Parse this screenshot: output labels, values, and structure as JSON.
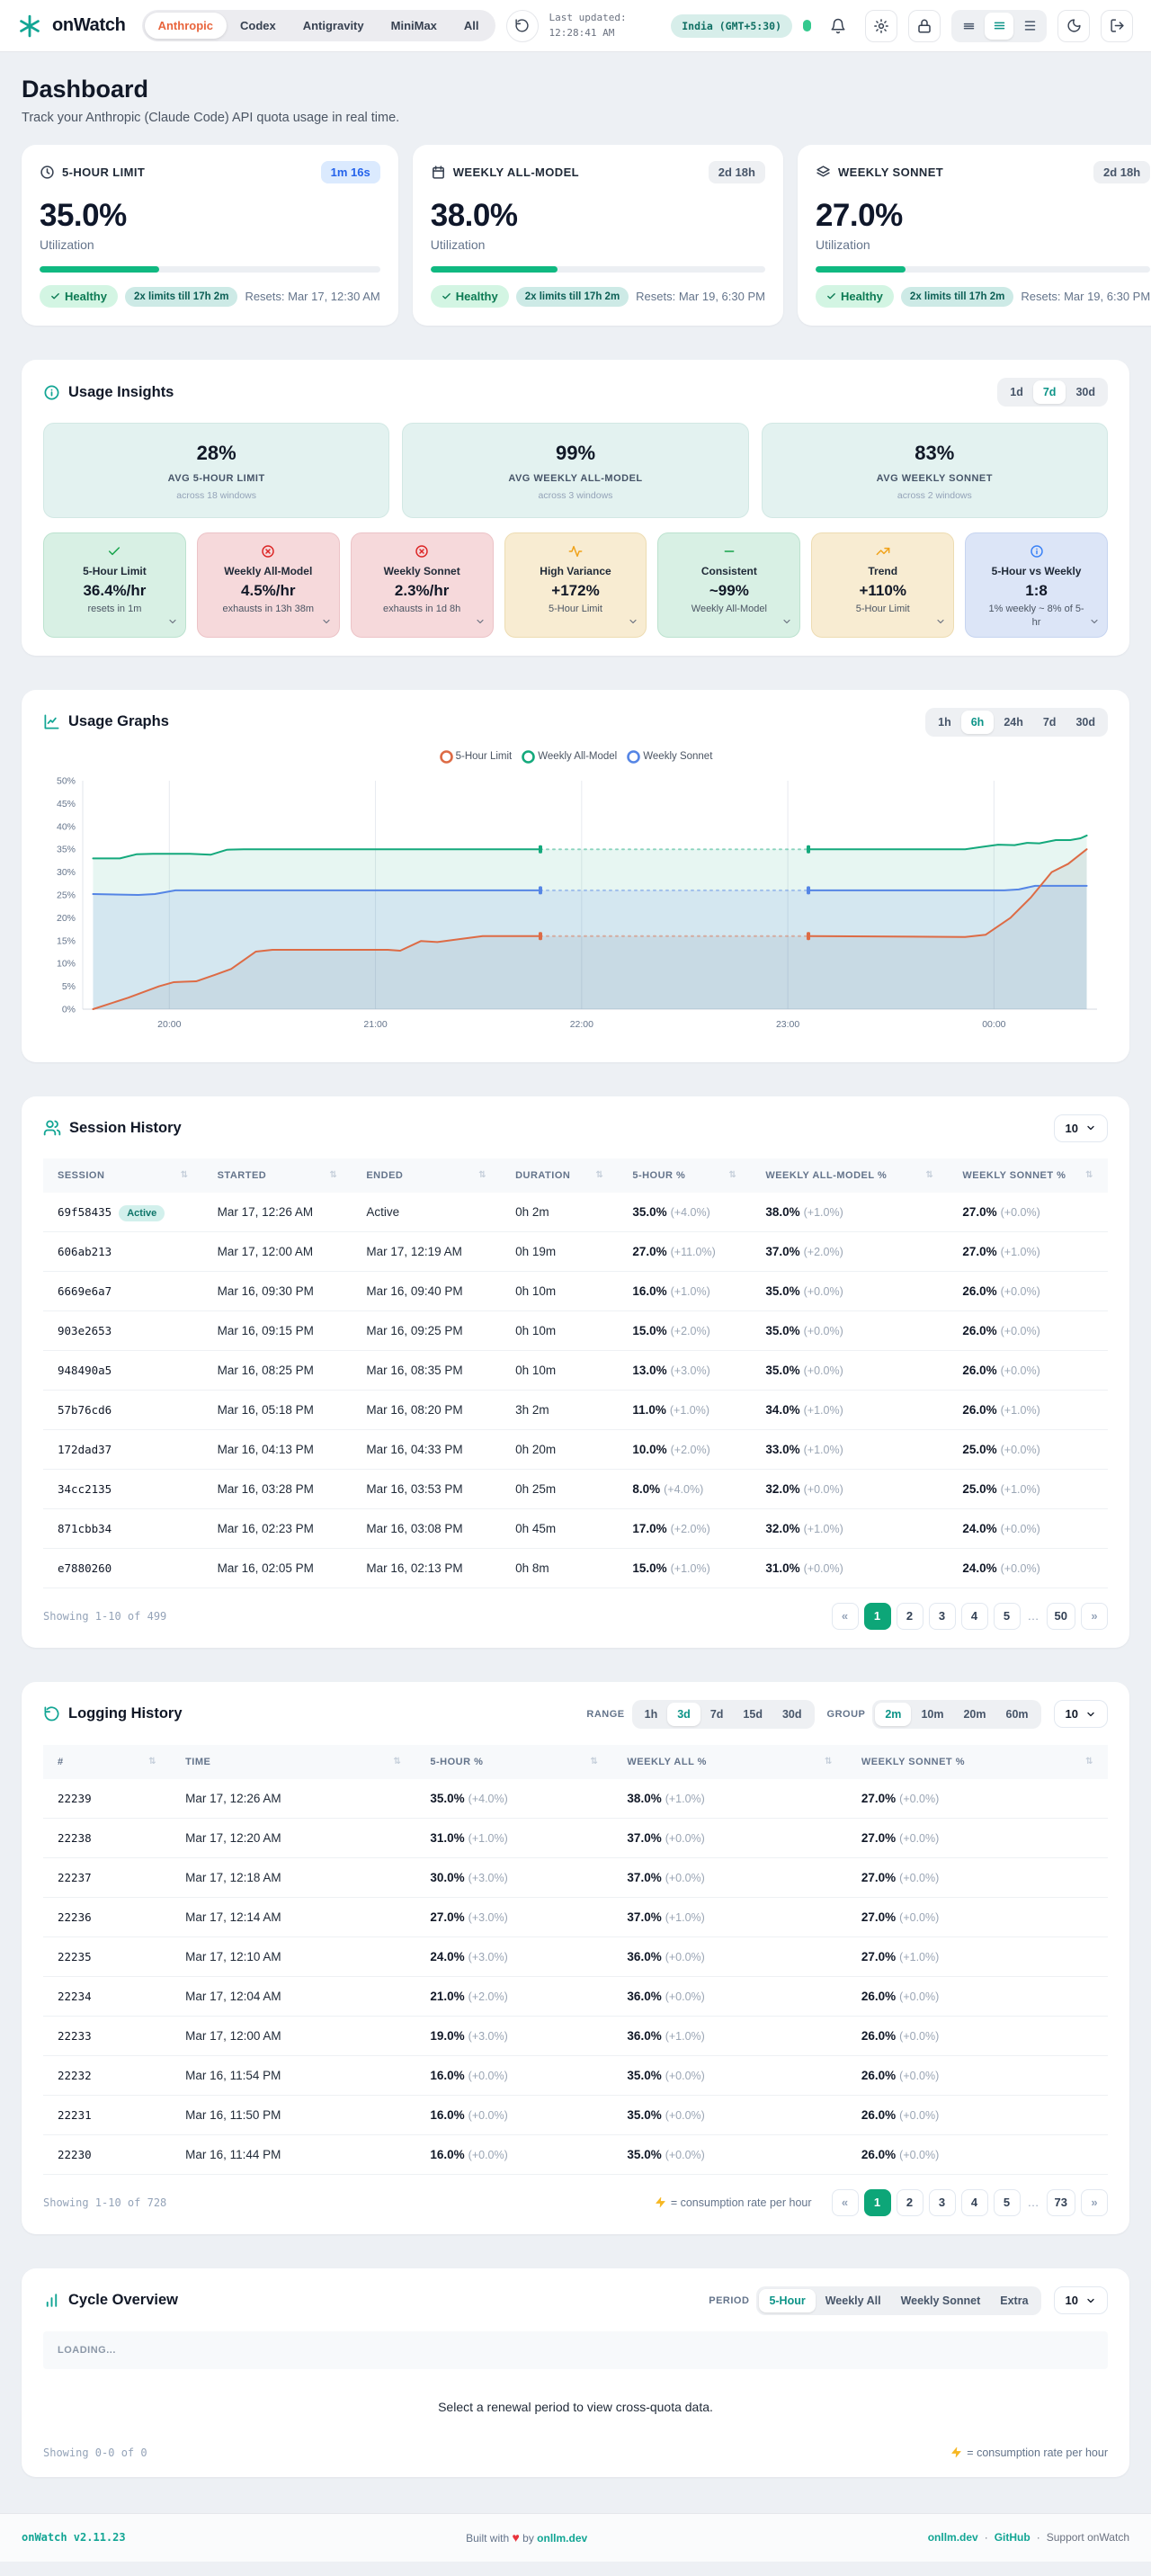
{
  "header": {
    "brand": "onWatch",
    "product_tabs": {
      "options": [
        "Anthropic",
        "Codex",
        "Antigravity",
        "MiniMax",
        "All"
      ],
      "active": "Anthropic"
    },
    "last_updated_label": "Last updated:",
    "last_updated_time": "12:28:41 AM",
    "timezone": "India (GMT+5:30)",
    "icons": [
      "logo-asterisk",
      "refresh-icon",
      "bell-icon",
      "gear-icon",
      "lock-icon",
      "density-compact-icon",
      "density-comfortable-icon",
      "density-spacious-icon",
      "moon-icon",
      "logout-icon"
    ]
  },
  "page": {
    "title": "Dashboard",
    "subtitle": "Track your Anthropic (Claude Code) API quota usage in real time."
  },
  "quota_cards": [
    {
      "icon": "clock-icon",
      "title": "5-HOUR LIMIT",
      "badge": "1m 16s",
      "badge_style": "blue",
      "value": "35.0%",
      "percent": 35,
      "label": "Utilization",
      "status": "Healthy",
      "boost": "2x limits till 17h 2m",
      "resets": "Resets: Mar 17, 12:30 AM"
    },
    {
      "icon": "calendar-icon",
      "title": "WEEKLY ALL-MODEL",
      "badge": "2d 18h",
      "badge_style": "gray",
      "value": "38.0%",
      "percent": 38,
      "label": "Utilization",
      "status": "Healthy",
      "boost": "2x limits till 17h 2m",
      "resets": "Resets: Mar 19, 6:30 PM"
    },
    {
      "icon": "layers-icon",
      "title": "WEEKLY SONNET",
      "badge": "2d 18h",
      "badge_style": "gray",
      "value": "27.0%",
      "percent": 27,
      "label": "Utilization",
      "status": "Healthy",
      "boost": "2x limits till 17h 2m",
      "resets": "Resets: Mar 19, 6:30 PM"
    }
  ],
  "insights": {
    "title": "Usage Insights",
    "icon": "info-circle-icon",
    "ranges": {
      "options": [
        "1d",
        "7d",
        "30d"
      ],
      "active": "7d"
    },
    "averages": [
      {
        "value": "28%",
        "label": "AVG 5-HOUR LIMIT",
        "sub": "across 18 windows"
      },
      {
        "value": "99%",
        "label": "AVG WEEKLY ALL-MODEL",
        "sub": "across 3 windows"
      },
      {
        "value": "83%",
        "label": "AVG WEEKLY SONNET",
        "sub": "across 2 windows"
      }
    ],
    "cards": [
      {
        "icon": "check-icon",
        "tone": "green",
        "title": "5-Hour Limit",
        "value": "36.4%/hr",
        "sub": "resets in 1m"
      },
      {
        "icon": "x-circle-icon",
        "tone": "red",
        "title": "Weekly All-Model",
        "value": "4.5%/hr",
        "sub": "exhausts in 13h 38m"
      },
      {
        "icon": "x-circle-icon",
        "tone": "red",
        "title": "Weekly Sonnet",
        "value": "2.3%/hr",
        "sub": "exhausts in 1d 8h"
      },
      {
        "icon": "activity-icon",
        "tone": "amber",
        "title": "High Variance",
        "value": "+172%",
        "sub": "5-Hour Limit"
      },
      {
        "icon": "minus-icon",
        "tone": "green",
        "title": "Consistent",
        "value": "~99%",
        "sub": "Weekly All-Model"
      },
      {
        "icon": "trend-up-icon",
        "tone": "amber",
        "title": "Trend",
        "value": "+110%",
        "sub": "5-Hour Limit"
      },
      {
        "icon": "clock-blue-icon",
        "tone": "blue",
        "title": "5-Hour vs Weekly",
        "value": "1:8",
        "sub": "1% weekly ~ 8% of 5-hr"
      }
    ]
  },
  "graphs": {
    "title": "Usage Graphs",
    "icon": "line-chart-icon",
    "ranges": {
      "options": [
        "1h",
        "6h",
        "24h",
        "7d",
        "30d"
      ],
      "active": "6h"
    }
  },
  "chart_data": {
    "type": "line",
    "title": "Usage Graphs",
    "x_domain": [
      19.58,
      24.5
    ],
    "ylim": [
      0,
      50
    ],
    "y_tick_step": 5,
    "grid": "vertical",
    "legend_position": "top-center",
    "x_ticks": [
      {
        "t": 20,
        "label": "20:00"
      },
      {
        "t": 21,
        "label": "21:00"
      },
      {
        "t": 22,
        "label": "22:00"
      },
      {
        "t": 23,
        "label": "23:00"
      },
      {
        "t": 24,
        "label": "00:00"
      }
    ],
    "gap_note": "dashed segment between ~21:48 and ~23:06 indicates missing samples",
    "series": [
      {
        "name": "5-Hour Limit",
        "color": "#dd6b45",
        "fill": "rgba(120,130,145,0.13)",
        "solid1": [
          [
            19.63,
            0
          ],
          [
            19.8,
            2.5
          ],
          [
            19.95,
            5
          ],
          [
            20.02,
            5.9
          ],
          [
            20.07,
            6
          ],
          [
            20.13,
            6.1
          ],
          [
            20.22,
            7.5
          ],
          [
            20.3,
            8.8
          ],
          [
            20.42,
            12.6
          ],
          [
            20.5,
            13
          ],
          [
            20.98,
            13
          ],
          [
            21.06,
            13
          ],
          [
            21.12,
            12.8
          ],
          [
            21.22,
            14.9
          ],
          [
            21.3,
            14.7
          ],
          [
            21.42,
            15.4
          ],
          [
            21.52,
            16
          ],
          [
            21.8,
            16
          ]
        ],
        "dashed": [
          [
            21.8,
            16
          ],
          [
            23.1,
            16
          ]
        ],
        "solid2": [
          [
            23.1,
            16
          ],
          [
            23.86,
            15.8
          ],
          [
            23.96,
            16.3
          ],
          [
            24.08,
            20
          ],
          [
            24.18,
            24.5
          ],
          [
            24.28,
            30
          ],
          [
            24.36,
            31.8
          ],
          [
            24.45,
            35
          ]
        ]
      },
      {
        "name": "Weekly All-Model",
        "color": "#14a97c",
        "fill": "rgba(20,169,124,0.10)",
        "solid1": [
          [
            19.63,
            33
          ],
          [
            19.76,
            33
          ],
          [
            19.84,
            33.9
          ],
          [
            19.92,
            34
          ],
          [
            20.1,
            34
          ],
          [
            20.2,
            33.8
          ],
          [
            20.28,
            34.9
          ],
          [
            20.36,
            35
          ],
          [
            21.8,
            35
          ]
        ],
        "dashed": [
          [
            21.8,
            35
          ],
          [
            23.1,
            35
          ]
        ],
        "solid2": [
          [
            23.1,
            35
          ],
          [
            23.86,
            35
          ],
          [
            23.94,
            35.5
          ],
          [
            24.02,
            36
          ],
          [
            24.1,
            35.9
          ],
          [
            24.16,
            36.4
          ],
          [
            24.22,
            36.3
          ],
          [
            24.3,
            37
          ],
          [
            24.37,
            37
          ],
          [
            24.42,
            37.4
          ],
          [
            24.45,
            38
          ]
        ]
      },
      {
        "name": "Weekly Sonnet",
        "color": "#5585e5",
        "fill": "rgba(85,133,229,0.13)",
        "solid1": [
          [
            19.63,
            25.2
          ],
          [
            19.85,
            25
          ],
          [
            19.93,
            25.2
          ],
          [
            20.03,
            26
          ],
          [
            21.8,
            26
          ]
        ],
        "dashed": [
          [
            21.8,
            26
          ],
          [
            23.1,
            26
          ]
        ],
        "solid2": [
          [
            23.1,
            26
          ],
          [
            24.05,
            26
          ],
          [
            24.12,
            26.2
          ],
          [
            24.2,
            27
          ],
          [
            24.45,
            27
          ]
        ]
      }
    ]
  },
  "sessions": {
    "title": "Session History",
    "icon": "users-icon",
    "per_page": "10",
    "columns": [
      "SESSION",
      "STARTED",
      "ENDED",
      "DURATION",
      "5-HOUR %",
      "WEEKLY ALL-MODEL %",
      "WEEKLY SONNET %"
    ],
    "rows": [
      {
        "id": "69f58435",
        "active_badge": "Active",
        "started": "Mar 17, 12:26 AM",
        "ended": "Active",
        "duration": "0h 2m",
        "five": "35.0%",
        "five_d": "(+4.0%)",
        "all": "38.0%",
        "all_d": "(+1.0%)",
        "sonnet": "27.0%",
        "sonnet_d": "(+0.0%)"
      },
      {
        "id": "606ab213",
        "started": "Mar 17, 12:00 AM",
        "ended": "Mar 17, 12:19 AM",
        "duration": "0h 19m",
        "five": "27.0%",
        "five_d": "(+11.0%)",
        "all": "37.0%",
        "all_d": "(+2.0%)",
        "sonnet": "27.0%",
        "sonnet_d": "(+1.0%)"
      },
      {
        "id": "6669e6a7",
        "started": "Mar 16, 09:30 PM",
        "ended": "Mar 16, 09:40 PM",
        "duration": "0h 10m",
        "five": "16.0%",
        "five_d": "(+1.0%)",
        "all": "35.0%",
        "all_d": "(+0.0%)",
        "sonnet": "26.0%",
        "sonnet_d": "(+0.0%)"
      },
      {
        "id": "903e2653",
        "started": "Mar 16, 09:15 PM",
        "ended": "Mar 16, 09:25 PM",
        "duration": "0h 10m",
        "five": "15.0%",
        "five_d": "(+2.0%)",
        "all": "35.0%",
        "all_d": "(+0.0%)",
        "sonnet": "26.0%",
        "sonnet_d": "(+0.0%)"
      },
      {
        "id": "948490a5",
        "started": "Mar 16, 08:25 PM",
        "ended": "Mar 16, 08:35 PM",
        "duration": "0h 10m",
        "five": "13.0%",
        "five_d": "(+3.0%)",
        "all": "35.0%",
        "all_d": "(+0.0%)",
        "sonnet": "26.0%",
        "sonnet_d": "(+0.0%)"
      },
      {
        "id": "57b76cd6",
        "started": "Mar 16, 05:18 PM",
        "ended": "Mar 16, 08:20 PM",
        "duration": "3h 2m",
        "five": "11.0%",
        "five_d": "(+1.0%)",
        "all": "34.0%",
        "all_d": "(+1.0%)",
        "sonnet": "26.0%",
        "sonnet_d": "(+1.0%)"
      },
      {
        "id": "172dad37",
        "started": "Mar 16, 04:13 PM",
        "ended": "Mar 16, 04:33 PM",
        "duration": "0h 20m",
        "five": "10.0%",
        "five_d": "(+2.0%)",
        "all": "33.0%",
        "all_d": "(+1.0%)",
        "sonnet": "25.0%",
        "sonnet_d": "(+0.0%)"
      },
      {
        "id": "34cc2135",
        "started": "Mar 16, 03:28 PM",
        "ended": "Mar 16, 03:53 PM",
        "duration": "0h 25m",
        "five": "8.0%",
        "five_d": "(+4.0%)",
        "all": "32.0%",
        "all_d": "(+0.0%)",
        "sonnet": "25.0%",
        "sonnet_d": "(+1.0%)"
      },
      {
        "id": "871cbb34",
        "started": "Mar 16, 02:23 PM",
        "ended": "Mar 16, 03:08 PM",
        "duration": "0h 45m",
        "five": "17.0%",
        "five_d": "(+2.0%)",
        "all": "32.0%",
        "all_d": "(+1.0%)",
        "sonnet": "24.0%",
        "sonnet_d": "(+0.0%)"
      },
      {
        "id": "e7880260",
        "started": "Mar 16, 02:05 PM",
        "ended": "Mar 16, 02:13 PM",
        "duration": "0h 8m",
        "five": "15.0%",
        "five_d": "(+1.0%)",
        "all": "31.0%",
        "all_d": "(+0.0%)",
        "sonnet": "24.0%",
        "sonnet_d": "(+0.0%)"
      }
    ],
    "showing": "Showing 1-10 of 499",
    "pagination": [
      "«",
      "1",
      "2",
      "3",
      "4",
      "5",
      "…",
      "50",
      "»"
    ],
    "page_active": "1"
  },
  "logging": {
    "title": "Logging History",
    "icon": "history-icon",
    "per_page": "10",
    "range_label": "RANGE",
    "range": {
      "options": [
        "1h",
        "3d",
        "7d",
        "15d",
        "30d"
      ],
      "active": "3d"
    },
    "group_label": "GROUP",
    "group": {
      "options": [
        "2m",
        "10m",
        "20m",
        "60m"
      ],
      "active": "2m"
    },
    "columns": [
      "#",
      "TIME",
      "5-HOUR %",
      "WEEKLY ALL %",
      "WEEKLY SONNET %"
    ],
    "rows": [
      {
        "num": "22239",
        "time": "Mar 17, 12:26 AM",
        "five": "35.0%",
        "five_d": "(+4.0%)",
        "all": "38.0%",
        "all_d": "(+1.0%)",
        "sonnet": "27.0%",
        "sonnet_d": "(+0.0%)"
      },
      {
        "num": "22238",
        "time": "Mar 17, 12:20 AM",
        "five": "31.0%",
        "five_d": "(+1.0%)",
        "all": "37.0%",
        "all_d": "(+0.0%)",
        "sonnet": "27.0%",
        "sonnet_d": "(+0.0%)"
      },
      {
        "num": "22237",
        "time": "Mar 17, 12:18 AM",
        "five": "30.0%",
        "five_d": "(+3.0%)",
        "all": "37.0%",
        "all_d": "(+0.0%)",
        "sonnet": "27.0%",
        "sonnet_d": "(+0.0%)"
      },
      {
        "num": "22236",
        "time": "Mar 17, 12:14 AM",
        "five": "27.0%",
        "five_d": "(+3.0%)",
        "all": "37.0%",
        "all_d": "(+1.0%)",
        "sonnet": "27.0%",
        "sonnet_d": "(+0.0%)"
      },
      {
        "num": "22235",
        "time": "Mar 17, 12:10 AM",
        "five": "24.0%",
        "five_d": "(+3.0%)",
        "all": "36.0%",
        "all_d": "(+0.0%)",
        "sonnet": "27.0%",
        "sonnet_d": "(+1.0%)"
      },
      {
        "num": "22234",
        "time": "Mar 17, 12:04 AM",
        "five": "21.0%",
        "five_d": "(+2.0%)",
        "all": "36.0%",
        "all_d": "(+0.0%)",
        "sonnet": "26.0%",
        "sonnet_d": "(+0.0%)"
      },
      {
        "num": "22233",
        "time": "Mar 17, 12:00 AM",
        "five": "19.0%",
        "five_d": "(+3.0%)",
        "all": "36.0%",
        "all_d": "(+1.0%)",
        "sonnet": "26.0%",
        "sonnet_d": "(+0.0%)"
      },
      {
        "num": "22232",
        "time": "Mar 16, 11:54 PM",
        "five": "16.0%",
        "five_d": "(+0.0%)",
        "all": "35.0%",
        "all_d": "(+0.0%)",
        "sonnet": "26.0%",
        "sonnet_d": "(+0.0%)"
      },
      {
        "num": "22231",
        "time": "Mar 16, 11:50 PM",
        "five": "16.0%",
        "five_d": "(+0.0%)",
        "all": "35.0%",
        "all_d": "(+0.0%)",
        "sonnet": "26.0%",
        "sonnet_d": "(+0.0%)"
      },
      {
        "num": "22230",
        "time": "Mar 16, 11:44 PM",
        "five": "16.0%",
        "five_d": "(+0.0%)",
        "all": "35.0%",
        "all_d": "(+0.0%)",
        "sonnet": "26.0%",
        "sonnet_d": "(+0.0%)"
      }
    ],
    "showing": "Showing 1-10 of 728",
    "zap_note": "= consumption rate per hour",
    "pagination": [
      "«",
      "1",
      "2",
      "3",
      "4",
      "5",
      "…",
      "73",
      "»"
    ],
    "page_active": "1"
  },
  "cycle": {
    "title": "Cycle Overview",
    "icon": "bar-chart-icon",
    "per_page": "10",
    "period_label": "PERIOD",
    "period": {
      "options": [
        "5-Hour",
        "Weekly All",
        "Weekly Sonnet",
        "Extra"
      ],
      "active": "5-Hour"
    },
    "loading": "LOADING...",
    "empty": "Select a renewal period to view cross-quota data.",
    "showing": "Showing 0-0 of 0",
    "zap_note": "= consumption rate per hour"
  },
  "footer": {
    "version": "onWatch v2.11.23",
    "built_prefix": "Built with",
    "heart": "♥",
    "built_suffix": "by",
    "built_link": "onllm.dev",
    "link1": "onllm.dev",
    "link2": "GitHub",
    "support": "Support onWatch",
    "separator": "·"
  },
  "colors": {
    "brand_teal": "#12a594",
    "active_tab_orange": "#e8643c",
    "progress_green": "#10b981",
    "pagination_active": "#0da678",
    "chart_orange": "#dd6b45",
    "chart_green": "#14a97c",
    "chart_blue": "#5585e5"
  }
}
